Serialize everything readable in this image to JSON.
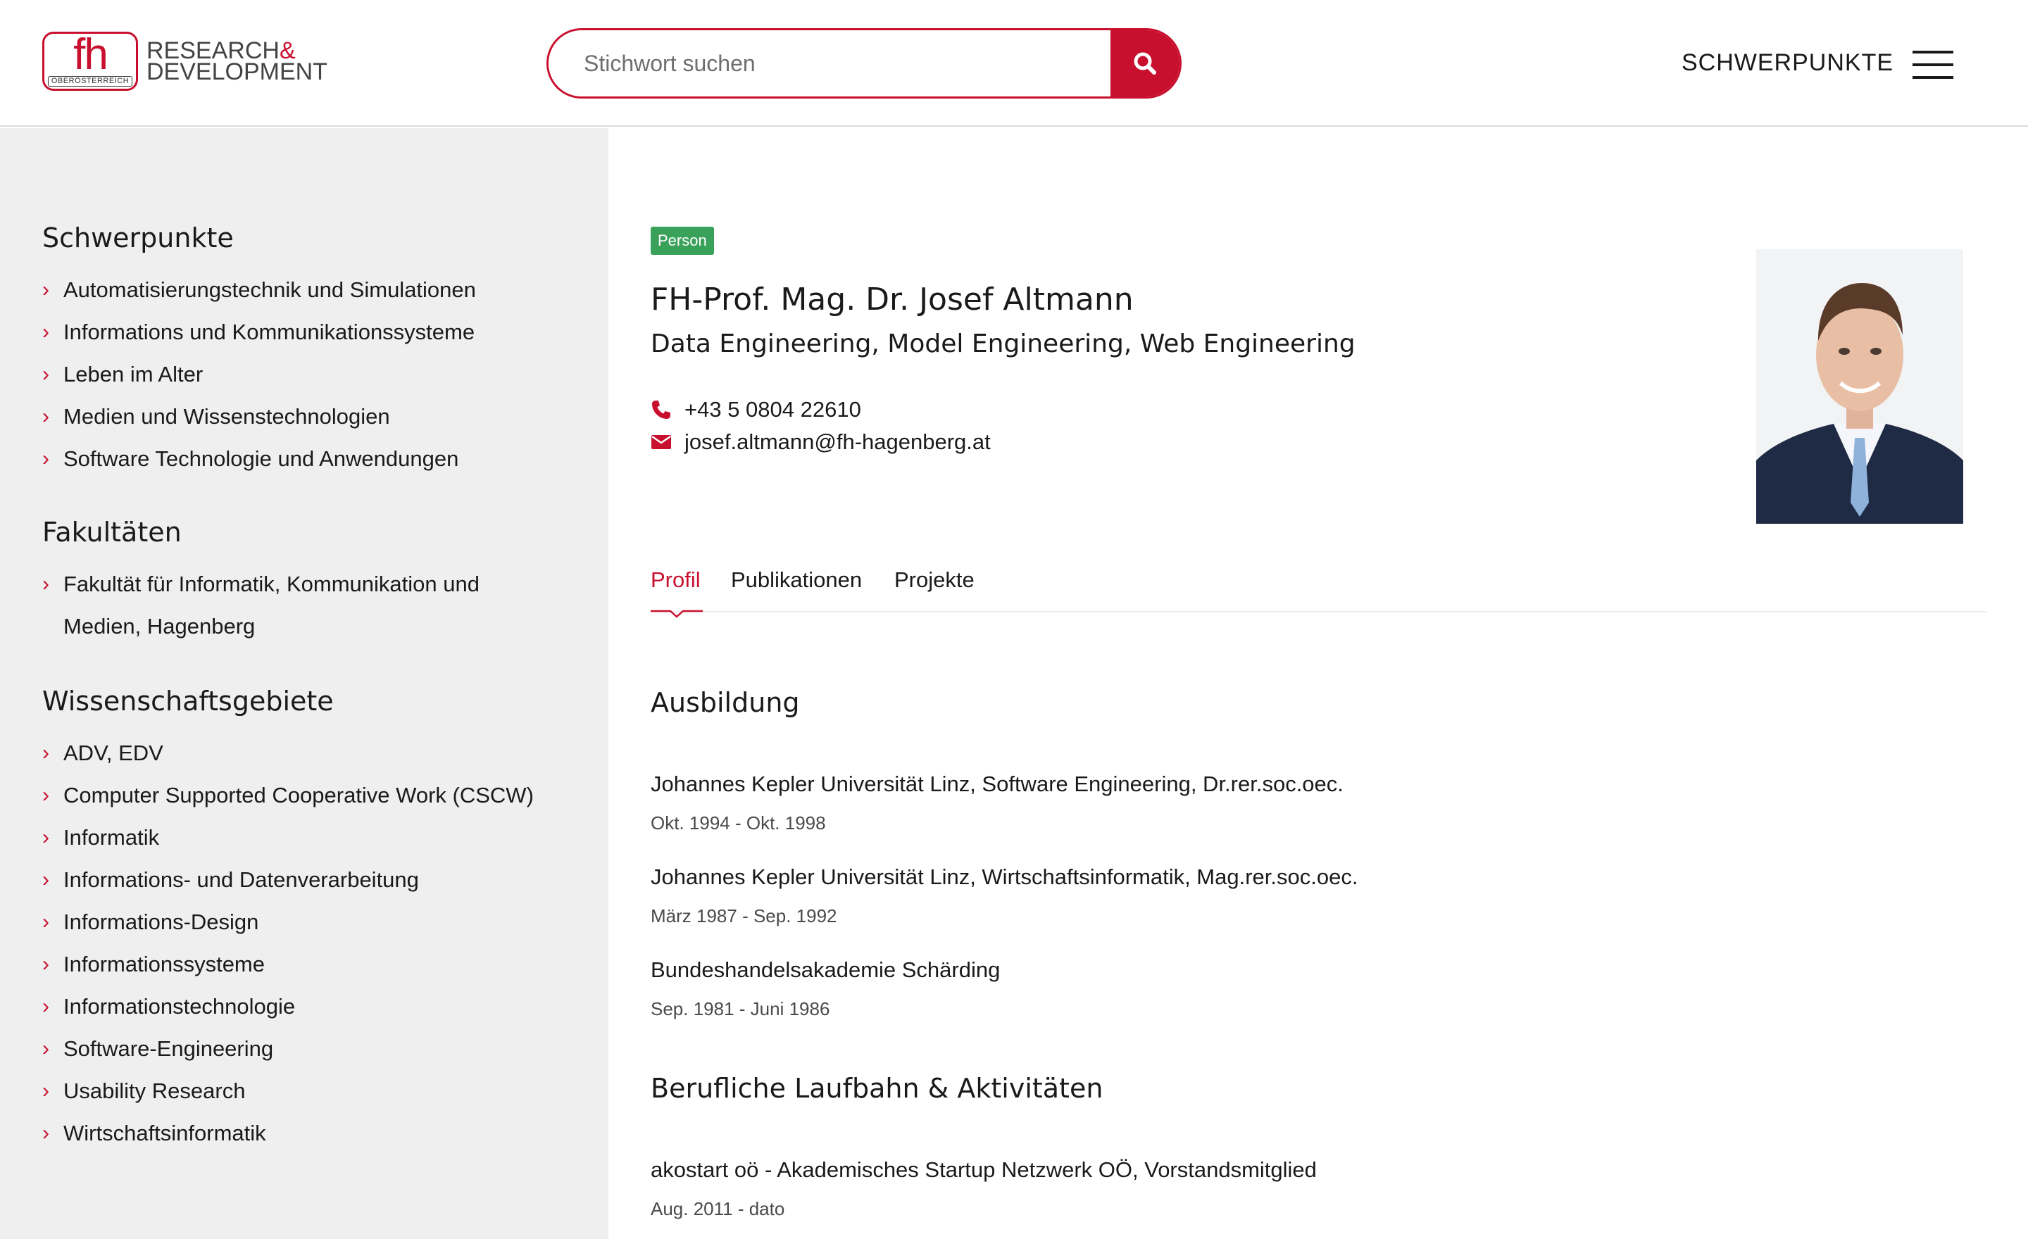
{
  "header": {
    "logo": {
      "mark": "fh",
      "sub": "OBERÖSTERREICH",
      "line1": "RESEARCH",
      "amp": "&",
      "line2": "DEVELOPMENT"
    },
    "search": {
      "placeholder": "Stichwort suchen",
      "icon": "search-icon"
    },
    "nav_label": "SCHWERPUNKTE",
    "menu_icon": "hamburger-icon"
  },
  "sidebar": {
    "sections": [
      {
        "heading": "Schwerpunkte",
        "items": [
          "Automatisierungstechnik und Simulationen",
          "Informations und Kommunikationssysteme",
          "Leben im Alter",
          "Medien und Wissenstechnologien",
          "Software Technologie und Anwendungen"
        ]
      },
      {
        "heading": "Fakultäten",
        "items": [
          "Fakultät für Informatik, Kommunikation und",
          "Medien, Hagenberg"
        ]
      },
      {
        "heading": "Wissenschaftsgebiete",
        "items": [
          "ADV, EDV",
          "Computer Supported Cooperative Work (CSCW)",
          "Informatik",
          "Informations- und Datenverarbeitung",
          "Informations-Design",
          "Informationssysteme",
          "Informationstechnologie",
          "Software-Engineering",
          "Usability Research",
          "Wirtschaftsinformatik"
        ]
      }
    ]
  },
  "profile": {
    "badge": "Person",
    "name": "FH-Prof. Mag. Dr. Josef Altmann",
    "subtitle": "Data Engineering, Model Engineering, Web Engineering",
    "phone": "+43 5 0804 22610",
    "email": "josef.altmann@fh-hagenberg.at",
    "accent_color": "#c8102e",
    "badge_color": "#3aa15a"
  },
  "tabs": [
    {
      "label": "Profil",
      "active": true
    },
    {
      "label": "Publikationen",
      "active": false
    },
    {
      "label": "Projekte",
      "active": false
    }
  ],
  "education": {
    "title": "Ausbildung",
    "entries": [
      {
        "title": "Johannes Kepler Universität Linz, Software Engineering, Dr.rer.soc.oec.",
        "date": "Okt. 1994 - Okt. 1998"
      },
      {
        "title": "Johannes Kepler Universität Linz, Wirtschaftsinformatik, Mag.rer.soc.oec.",
        "date": "März 1987 - Sep. 1992"
      },
      {
        "title": "Bundeshandelsakademie Schärding",
        "date": "Sep. 1981 - Juni 1986"
      }
    ]
  },
  "career": {
    "title": "Berufliche Laufbahn & Aktivitäten",
    "entries": [
      {
        "title": "akostart oö - Akademisches Startup Netzwerk OÖ, Vorstandsmitglied",
        "date": "Aug. 2011 - dato"
      }
    ]
  }
}
